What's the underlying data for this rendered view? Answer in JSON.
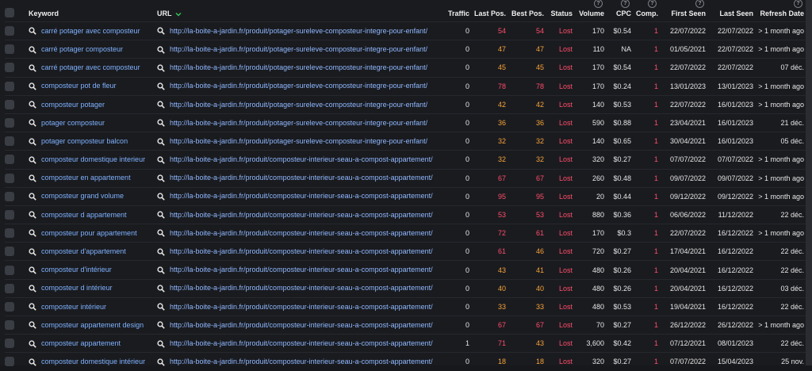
{
  "header": {
    "keyword": "Keyword",
    "url": "URL",
    "traffic": "Traffic",
    "last_pos": "Last Pos.",
    "best_pos": "Best Pos.",
    "status": "Status",
    "volume": "Volume",
    "cpc": "CPC",
    "comp": "Comp.",
    "first_seen": "First Seen",
    "last_seen": "Last Seen",
    "refresh_date": "Refresh Date",
    "help_glyph": "?"
  },
  "colors": {
    "lost": "#ff4d6b",
    "pos_red": "#ff4d6b",
    "pos_orange": "#f7a33a",
    "link": "#7fb2ff"
  },
  "rows": [
    {
      "keyword": "carré potager avec composteur",
      "url": "http://la-boite-a-jardin.fr/produit/potager-sureleve-composteur-integre-pour-enfant/",
      "traffic": "0",
      "last": "54",
      "last_color": "red",
      "best": "54",
      "best_color": "red",
      "status": "Lost",
      "volume": "170",
      "cpc": "$0.54",
      "comp": "1",
      "first": "22/07/2022",
      "lastseen": "22/07/2022",
      "refresh": "> 1 month ago"
    },
    {
      "keyword": "carré potager composteur",
      "url": "http://la-boite-a-jardin.fr/produit/potager-sureleve-composteur-integre-pour-enfant/",
      "traffic": "0",
      "last": "47",
      "last_color": "orange",
      "best": "47",
      "best_color": "orange",
      "status": "Lost",
      "volume": "110",
      "cpc": "NA",
      "comp": "1",
      "first": "01/05/2021",
      "lastseen": "22/07/2022",
      "refresh": "> 1 month ago"
    },
    {
      "keyword": "carré potager avec composteur",
      "url": "http://la-boite-a-jardin.fr/produit/potager-sureleve-composteur-integre-pour-enfant/",
      "traffic": "0",
      "last": "45",
      "last_color": "orange",
      "best": "45",
      "best_color": "orange",
      "status": "Lost",
      "volume": "170",
      "cpc": "$0.54",
      "comp": "1",
      "first": "22/07/2022",
      "lastseen": "22/07/2022",
      "refresh": "07 déc."
    },
    {
      "keyword": "composteur pot de fleur",
      "url": "http://la-boite-a-jardin.fr/produit/potager-sureleve-composteur-integre-pour-enfant/",
      "traffic": "0",
      "last": "78",
      "last_color": "red",
      "best": "78",
      "best_color": "red",
      "status": "Lost",
      "volume": "170",
      "cpc": "$0.24",
      "comp": "1",
      "first": "13/01/2023",
      "lastseen": "13/01/2023",
      "refresh": "> 1 month ago"
    },
    {
      "keyword": "composteur potager",
      "url": "http://la-boite-a-jardin.fr/produit/potager-sureleve-composteur-integre-pour-enfant/",
      "traffic": "0",
      "last": "42",
      "last_color": "orange",
      "best": "42",
      "best_color": "orange",
      "status": "Lost",
      "volume": "140",
      "cpc": "$0.53",
      "comp": "1",
      "first": "22/07/2022",
      "lastseen": "16/01/2023",
      "refresh": "> 1 month ago"
    },
    {
      "keyword": "potager composteur",
      "url": "http://la-boite-a-jardin.fr/produit/potager-sureleve-composteur-integre-pour-enfant/",
      "traffic": "0",
      "last": "36",
      "last_color": "orange",
      "best": "36",
      "best_color": "orange",
      "status": "Lost",
      "volume": "590",
      "cpc": "$0.88",
      "comp": "1",
      "first": "23/04/2021",
      "lastseen": "16/01/2023",
      "refresh": "21 déc."
    },
    {
      "keyword": "potager composteur balcon",
      "url": "http://la-boite-a-jardin.fr/produit/potager-sureleve-composteur-integre-pour-enfant/",
      "traffic": "0",
      "last": "32",
      "last_color": "orange",
      "best": "32",
      "best_color": "orange",
      "status": "Lost",
      "volume": "140",
      "cpc": "$0.65",
      "comp": "1",
      "first": "30/04/2021",
      "lastseen": "16/01/2023",
      "refresh": "05 déc."
    },
    {
      "keyword": "composteur domestique interieur",
      "url": "http://la-boite-a-jardin.fr/produit/composteur-interieur-seau-a-compost-appartement/",
      "traffic": "0",
      "last": "32",
      "last_color": "orange",
      "best": "32",
      "best_color": "orange",
      "status": "Lost",
      "volume": "320",
      "cpc": "$0.27",
      "comp": "1",
      "first": "07/07/2022",
      "lastseen": "07/07/2022",
      "refresh": "> 1 month ago"
    },
    {
      "keyword": "composteur en appartement",
      "url": "http://la-boite-a-jardin.fr/produit/composteur-interieur-seau-a-compost-appartement/",
      "traffic": "0",
      "last": "67",
      "last_color": "red",
      "best": "67",
      "best_color": "red",
      "status": "Lost",
      "volume": "260",
      "cpc": "$0.48",
      "comp": "1",
      "first": "09/07/2022",
      "lastseen": "09/07/2022",
      "refresh": "> 1 month ago"
    },
    {
      "keyword": "composteur grand volume",
      "url": "http://la-boite-a-jardin.fr/produit/composteur-interieur-seau-a-compost-appartement/",
      "traffic": "0",
      "last": "95",
      "last_color": "red",
      "best": "95",
      "best_color": "red",
      "status": "Lost",
      "volume": "20",
      "cpc": "$0.44",
      "comp": "1",
      "first": "09/12/2022",
      "lastseen": "09/12/2022",
      "refresh": "> 1 month ago"
    },
    {
      "keyword": "composteur d appartement",
      "url": "http://la-boite-a-jardin.fr/produit/composteur-interieur-seau-a-compost-appartement/",
      "traffic": "0",
      "last": "53",
      "last_color": "red",
      "best": "53",
      "best_color": "red",
      "status": "Lost",
      "volume": "880",
      "cpc": "$0.36",
      "comp": "1",
      "first": "06/06/2022",
      "lastseen": "11/12/2022",
      "refresh": "22 déc."
    },
    {
      "keyword": "composteur pour appartement",
      "url": "http://la-boite-a-jardin.fr/produit/composteur-interieur-seau-a-compost-appartement/",
      "traffic": "0",
      "last": "72",
      "last_color": "red",
      "best": "61",
      "best_color": "red",
      "status": "Lost",
      "volume": "170",
      "cpc": "$0.3",
      "comp": "1",
      "first": "22/07/2022",
      "lastseen": "16/12/2022",
      "refresh": "> 1 month ago"
    },
    {
      "keyword": "composteur d'appartement",
      "url": "http://la-boite-a-jardin.fr/produit/composteur-interieur-seau-a-compost-appartement/",
      "traffic": "0",
      "last": "61",
      "last_color": "red",
      "best": "46",
      "best_color": "orange",
      "status": "Lost",
      "volume": "720",
      "cpc": "$0.27",
      "comp": "1",
      "first": "17/04/2021",
      "lastseen": "16/12/2022",
      "refresh": "22 déc."
    },
    {
      "keyword": "composteur d'intérieur",
      "url": "http://la-boite-a-jardin.fr/produit/composteur-interieur-seau-a-compost-appartement/",
      "traffic": "0",
      "last": "43",
      "last_color": "orange",
      "best": "41",
      "best_color": "orange",
      "status": "Lost",
      "volume": "480",
      "cpc": "$0.26",
      "comp": "1",
      "first": "20/04/2021",
      "lastseen": "16/12/2022",
      "refresh": "22 déc."
    },
    {
      "keyword": "composteur d intérieur",
      "url": "http://la-boite-a-jardin.fr/produit/composteur-interieur-seau-a-compost-appartement/",
      "traffic": "0",
      "last": "40",
      "last_color": "orange",
      "best": "40",
      "best_color": "orange",
      "status": "Lost",
      "volume": "480",
      "cpc": "$0.26",
      "comp": "1",
      "first": "20/04/2021",
      "lastseen": "16/12/2022",
      "refresh": "03 déc."
    },
    {
      "keyword": "composteur intérieur",
      "url": "http://la-boite-a-jardin.fr/produit/composteur-interieur-seau-a-compost-appartement/",
      "traffic": "0",
      "last": "33",
      "last_color": "orange",
      "best": "33",
      "best_color": "orange",
      "status": "Lost",
      "volume": "480",
      "cpc": "$0.53",
      "comp": "1",
      "first": "19/04/2021",
      "lastseen": "16/12/2022",
      "refresh": "22 déc."
    },
    {
      "keyword": "composteur appartement design",
      "url": "http://la-boite-a-jardin.fr/produit/composteur-interieur-seau-a-compost-appartement/",
      "traffic": "0",
      "last": "67",
      "last_color": "red",
      "best": "67",
      "best_color": "red",
      "status": "Lost",
      "volume": "70",
      "cpc": "$0.27",
      "comp": "1",
      "first": "26/12/2022",
      "lastseen": "26/12/2022",
      "refresh": "> 1 month ago"
    },
    {
      "keyword": "composteur appartement",
      "url": "http://la-boite-a-jardin.fr/produit/composteur-interieur-seau-a-compost-appartement/",
      "traffic": "1",
      "last": "71",
      "last_color": "red",
      "best": "43",
      "best_color": "orange",
      "status": "Lost",
      "volume": "3,600",
      "cpc": "$0.42",
      "comp": "1",
      "first": "07/12/2021",
      "lastseen": "08/01/2023",
      "refresh": "22 déc."
    },
    {
      "keyword": "composteur domestique intérieur",
      "url": "http://la-boite-a-jardin.fr/produit/composteur-interieur-seau-a-compost-appartement/",
      "traffic": "0",
      "last": "18",
      "last_color": "orange",
      "best": "18",
      "best_color": "orange",
      "status": "Lost",
      "volume": "320",
      "cpc": "$0.27",
      "comp": "1",
      "first": "07/07/2022",
      "lastseen": "15/04/2023",
      "refresh": "25 nov."
    }
  ]
}
